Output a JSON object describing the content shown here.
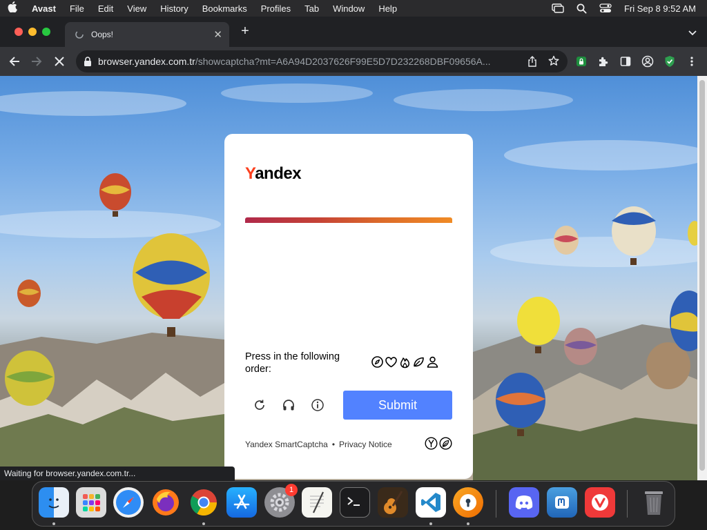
{
  "menubar": {
    "app_name": "Avast",
    "items": [
      "File",
      "Edit",
      "View",
      "History",
      "Bookmarks",
      "Profiles",
      "Tab",
      "Window",
      "Help"
    ],
    "clock": "Fri Sep 8  9:52 AM"
  },
  "browser": {
    "tab_title": "Oops!",
    "url_host": "browser.yandex.com.tr",
    "url_path": "/showcaptcha?mt=A6A94D2037626F99E5D7D232268DBF09656A...",
    "status_text": "Waiting for browser.yandex.com.tr..."
  },
  "captcha": {
    "logo_first": "Y",
    "logo_rest": "andex",
    "prompt": "Press in the following order:",
    "sequence_icons": [
      "compass-icon",
      "heart-icon",
      "flame-icon",
      "leaf-icon",
      "person-icon"
    ],
    "submit_label": "Submit",
    "footer_brand": "Yandex SmartCaptcha",
    "footer_separator": "•",
    "footer_privacy": "Privacy Notice",
    "colors": {
      "submit": "#5282ff",
      "logo_y": "#fc3f1d"
    }
  },
  "dock": {
    "apps": [
      "Finder",
      "Launchpad",
      "Safari",
      "Firefox",
      "Chrome",
      "App Store",
      "System Settings",
      "TextEdit",
      "Terminal",
      "GarageBand",
      "Visual Studio Code",
      "Avast Secure Browser",
      "Discord",
      "Mastodon",
      "Vivaldi",
      "Trash"
    ],
    "settings_badge": "1"
  }
}
